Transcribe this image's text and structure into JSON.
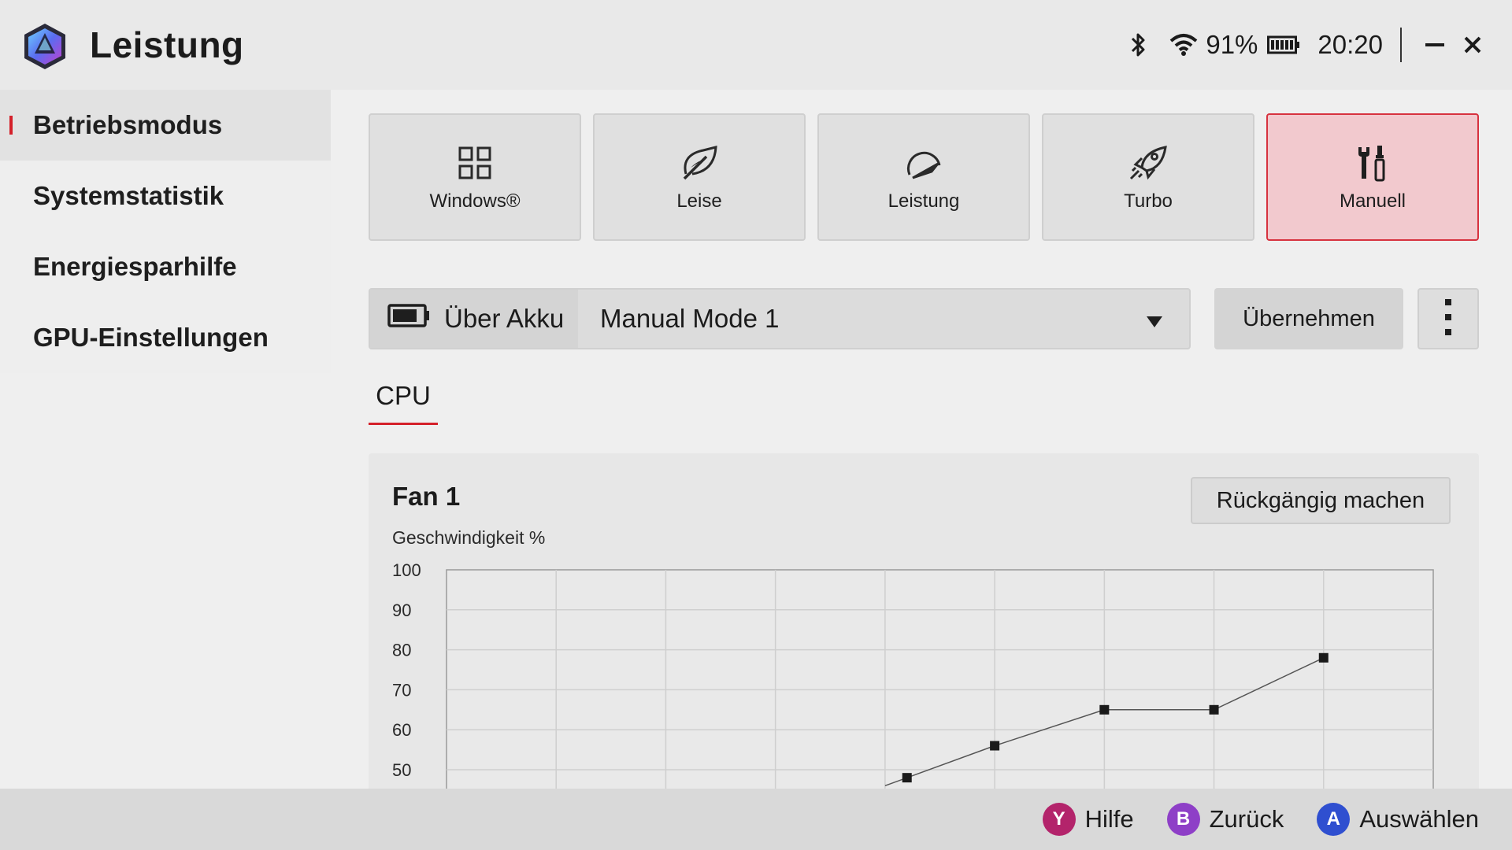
{
  "window": {
    "title": "Leistung",
    "battery_percent_text": "91%",
    "time": "20:20"
  },
  "sidebar": {
    "items": [
      {
        "label": "Betriebsmodus",
        "active": true
      },
      {
        "label": "Systemstatistik",
        "active": false
      },
      {
        "label": "Energiesparhilfe",
        "active": false
      },
      {
        "label": "GPU-Einstellungen",
        "active": false
      }
    ]
  },
  "modes": [
    {
      "label": "Windows®",
      "icon": "windows-grid-icon",
      "selected": false
    },
    {
      "label": "Leise",
      "icon": "leaf-icon",
      "selected": false
    },
    {
      "label": "Leistung",
      "icon": "speedometer-icon",
      "selected": false
    },
    {
      "label": "Turbo",
      "icon": "rocket-icon",
      "selected": false
    },
    {
      "label": "Manuell",
      "icon": "tools-icon",
      "selected": true
    }
  ],
  "profile": {
    "power_source": "Über Akku",
    "selected_profile": "Manual Mode 1",
    "apply_label": "Übernehmen"
  },
  "tabs": {
    "cpu": "CPU"
  },
  "fan": {
    "title": "Fan 1",
    "undo_label": "Rückgängig machen",
    "y_axis_label": "Geschwindigkeit %"
  },
  "chart_data": {
    "type": "line",
    "title": "Fan 1",
    "ylabel": "Geschwindigkeit %",
    "y_ticks": [
      100,
      90,
      80,
      70,
      60,
      50
    ],
    "ylim": [
      50,
      100
    ],
    "x_columns": 9,
    "grid": true,
    "series": [
      {
        "points": [
          [
            4.2,
            48
          ],
          [
            5,
            56
          ],
          [
            6,
            65
          ],
          [
            7,
            65
          ],
          [
            8,
            78
          ]
        ]
      }
    ],
    "colors": {
      "line": "#555555",
      "marker": "#1a1a1a",
      "grid": "#cfcfcf"
    }
  },
  "hints": [
    {
      "key": "Y",
      "label": "Hilfe",
      "color": "#b3246b"
    },
    {
      "key": "B",
      "label": "Zurück",
      "color": "#8e3fc7"
    },
    {
      "key": "A",
      "label": "Auswählen",
      "color": "#2f4fd0"
    }
  ],
  "colors": {
    "accent": "#d4202a",
    "selected_tile_bg": "#f2c9ce"
  }
}
